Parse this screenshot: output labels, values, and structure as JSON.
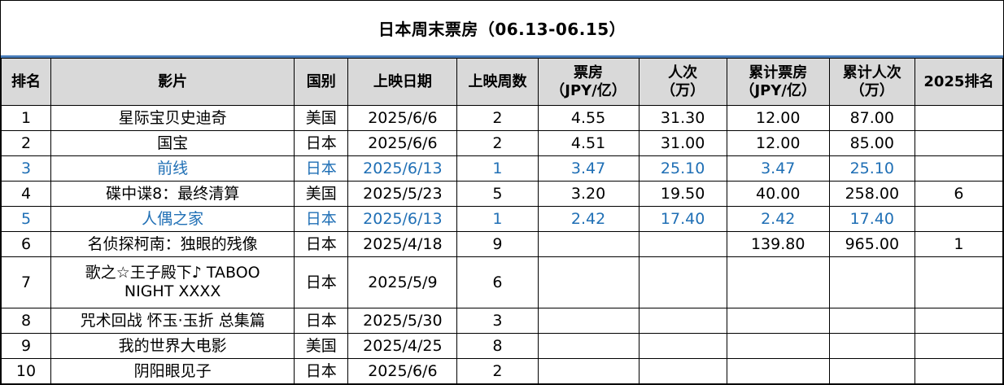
{
  "title": "日本周末票房（06.13-06.15）",
  "headers": {
    "rank": "排名",
    "film": "影片",
    "country": "国别",
    "release_date": "上映日期",
    "weeks": "上映周数",
    "box_office_1": "票房",
    "box_office_2": "（JPY/亿）",
    "admissions_1": "人次",
    "admissions_2": "（万）",
    "cum_box_office_1": "累计票房",
    "cum_box_office_2": "（JPY/亿）",
    "cum_admissions_1": "累计人次",
    "cum_admissions_2": "（万）",
    "rank_2025": "2025排名"
  },
  "rows": [
    {
      "rank": "1",
      "film": "星际宝贝史迪奇",
      "country": "美国",
      "release_date": "2025/6/6",
      "weeks": "2",
      "box_office": "4.55",
      "admissions": "31.30",
      "cum_box_office": "12.00",
      "cum_admissions": "87.00",
      "rank_2025": ""
    },
    {
      "rank": "2",
      "film": "国宝",
      "country": "日本",
      "release_date": "2025/6/6",
      "weeks": "2",
      "box_office": "4.51",
      "admissions": "31.00",
      "cum_box_office": "12.00",
      "cum_admissions": "85.00",
      "rank_2025": ""
    },
    {
      "rank": "3",
      "film": "前线",
      "country": "日本",
      "release_date": "2025/6/13",
      "weeks": "1",
      "box_office": "3.47",
      "admissions": "25.10",
      "cum_box_office": "3.47",
      "cum_admissions": "25.10",
      "rank_2025": ""
    },
    {
      "rank": "4",
      "film": "碟中谍8：最终清算",
      "country": "美国",
      "release_date": "2025/5/23",
      "weeks": "5",
      "box_office": "3.20",
      "admissions": "19.50",
      "cum_box_office": "40.00",
      "cum_admissions": "258.00",
      "rank_2025": "6"
    },
    {
      "rank": "5",
      "film": "人偶之家",
      "country": "日本",
      "release_date": "2025/6/13",
      "weeks": "1",
      "box_office": "2.42",
      "admissions": "17.40",
      "cum_box_office": "2.42",
      "cum_admissions": "17.40",
      "rank_2025": ""
    },
    {
      "rank": "6",
      "film": "名侦探柯南：独眼的残像",
      "country": "日本",
      "release_date": "2025/4/18",
      "weeks": "9",
      "box_office": "",
      "admissions": "",
      "cum_box_office": "139.80",
      "cum_admissions": "965.00",
      "rank_2025": "1"
    },
    {
      "rank": "7",
      "film_line1": "歌之☆王子殿下♪ TABOO",
      "film_line2": "NIGHT XXXX",
      "country": "日本",
      "release_date": "2025/5/9",
      "weeks": "6",
      "box_office": "",
      "admissions": "",
      "cum_box_office": "",
      "cum_admissions": "",
      "rank_2025": ""
    },
    {
      "rank": "8",
      "film": "咒术回战 怀玉·玉折 总集篇",
      "country": "日本",
      "release_date": "2025/5/30",
      "weeks": "3",
      "box_office": "",
      "admissions": "",
      "cum_box_office": "",
      "cum_admissions": "",
      "rank_2025": ""
    },
    {
      "rank": "9",
      "film": "我的世界大电影",
      "country": "美国",
      "release_date": "2025/4/25",
      "weeks": "8",
      "box_office": "",
      "admissions": "",
      "cum_box_office": "",
      "cum_admissions": "",
      "rank_2025": ""
    },
    {
      "rank": "10",
      "film": "阴阳眼见子",
      "country": "日本",
      "release_date": "2025/6/6",
      "weeks": "2",
      "box_office": "",
      "admissions": "",
      "cum_box_office": "",
      "cum_admissions": "",
      "rank_2025": ""
    }
  ],
  "colors": {
    "header_bg": "#d9d9d9",
    "new_release_text": "#1f6fb5",
    "title_rule": "#4a7ebb"
  }
}
